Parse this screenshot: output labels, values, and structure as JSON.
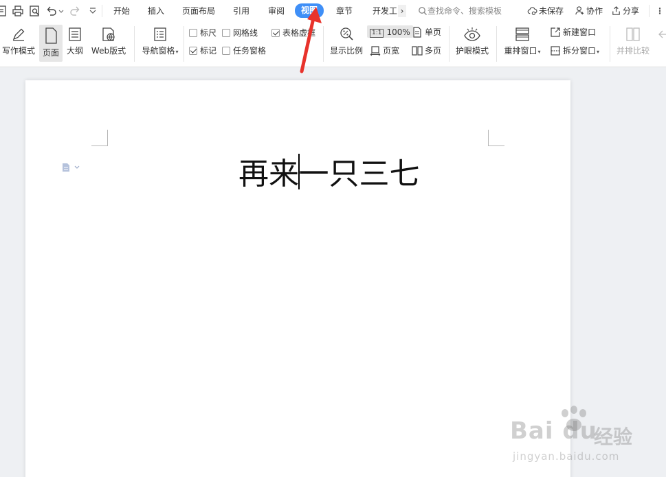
{
  "menu": {
    "tabs": [
      {
        "id": "home",
        "label": "开始"
      },
      {
        "id": "insert",
        "label": "插入"
      },
      {
        "id": "layout",
        "label": "页面布局"
      },
      {
        "id": "references",
        "label": "引用"
      },
      {
        "id": "review",
        "label": "审阅"
      },
      {
        "id": "view",
        "label": "视图",
        "active": true
      },
      {
        "id": "chapter",
        "label": "章节"
      },
      {
        "id": "developer",
        "label": "开发工"
      }
    ],
    "more_arrow": "›",
    "search_placeholder": "查找命令、搜索模板",
    "unsaved_label": "未保存",
    "collab_label": "协作",
    "share_label": "分享",
    "accent_color": "#3f8ff7"
  },
  "ribbon": {
    "write_mode": "写作模式",
    "page": "页面",
    "outline": "大纲",
    "web_layout": "Web版式",
    "nav_pane": "导航窗格",
    "ruler": {
      "label": "标尺",
      "checked": false
    },
    "gridlines": {
      "label": "网格线",
      "checked": false
    },
    "table_gridlines": {
      "label": "表格虚框",
      "checked": true
    },
    "marks": {
      "label": "标记",
      "checked": true
    },
    "task_pane": {
      "label": "任务窗格",
      "checked": false
    },
    "zoom_ratio": "显示比例",
    "zoom_100_icon": "1:1",
    "zoom_100": "100%",
    "page_width": "页宽",
    "single_page": "单页",
    "multi_page": "多页",
    "eye_mode": "护眼模式",
    "arrange_windows": "重排窗口",
    "new_window": "新建窗口",
    "split_window": "拆分窗口",
    "side_by_side": "并排比较"
  },
  "document": {
    "text_before_cursor": "再来",
    "text_after_cursor": "一只三七"
  },
  "watermark": {
    "brand": "Bai du",
    "cn": "经验",
    "url": "jingyan.baidu.com"
  }
}
